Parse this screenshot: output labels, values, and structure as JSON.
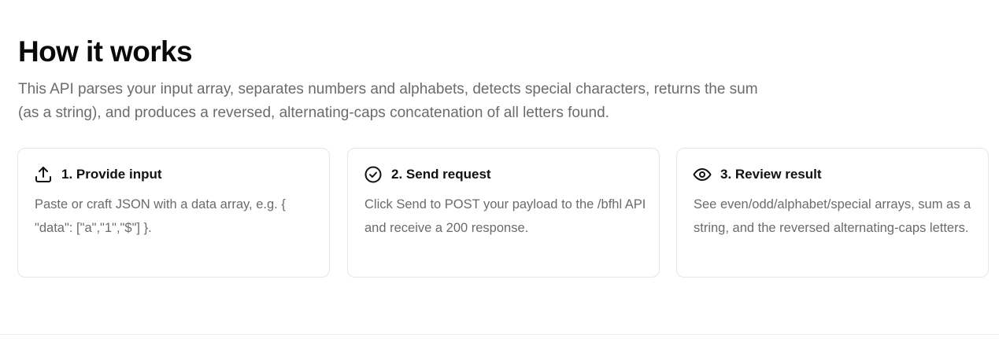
{
  "section": {
    "title": "How it works",
    "description": "This API parses your input array, separates numbers and alphabets, detects special characters, returns the sum (as a string), and produces a reversed, alternating-caps concatenation of all letters found."
  },
  "steps": [
    {
      "icon": "upload-icon",
      "title": "1. Provide input",
      "text": "Paste or craft JSON with a data array, e.g. { \"data\": [\"a\",\"1\",\"$\"] }."
    },
    {
      "icon": "check-circle-icon",
      "title": "2. Send request",
      "text": "Click Send to POST your payload to the /bfhl API and receive a 200 response."
    },
    {
      "icon": "eye-icon",
      "title": "3. Review result",
      "text": "See even/odd/alphabet/special arrays, sum as a string, and the reversed alternating-caps letters."
    }
  ],
  "colors": {
    "heading": "#0a0a0a",
    "muted_text": "#6b6b6b",
    "card_border": "#e6e6e6",
    "divider": "#ececec"
  }
}
